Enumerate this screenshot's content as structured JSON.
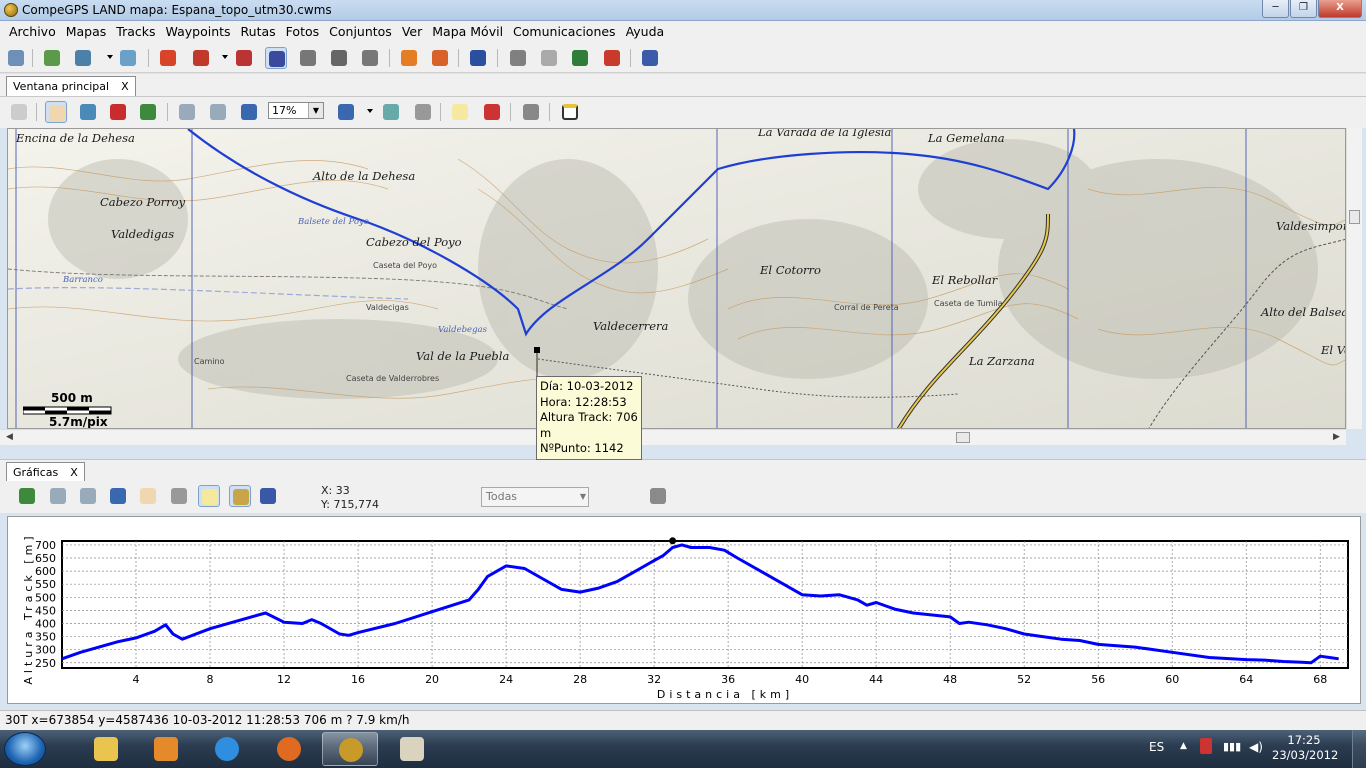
{
  "window": {
    "title": "CompeGPS LAND mapa: Espana_topo_utm30.cwms",
    "buttons": [
      "─",
      "❐",
      "X"
    ]
  },
  "menu": [
    "Archivo",
    "Mapas",
    "Tracks",
    "Waypoints",
    "Rutas",
    "Fotos",
    "Conjuntos",
    "Ver",
    "Mapa Móvil",
    "Comunicaciones",
    "Ayuda"
  ],
  "map_window": {
    "tab_label": "Ventana principal",
    "tab_close": "X",
    "zoom_value": "17%",
    "scale_distance": "500 m",
    "scale_resolution": "5.7m/pix",
    "tooltip": {
      "date": "Día: 10-03-2012",
      "time": "Hora: 12:28:53",
      "altitude": "Altura Track: 706 m",
      "point": "NºPunto: 1142"
    },
    "place_labels": [
      "Encina de la Dehesa",
      "Alto de la Dehesa",
      "Cabezo Porroy",
      "Valdedigas",
      "Cabezo del Poyo",
      "Val de la Puebla",
      "Valdecerrera",
      "La Varada de la Iglesia",
      "La Gemelana",
      "El Cotorro",
      "El Rebollar",
      "La Zarzana",
      "Valdesimpor",
      "Alto del Balsea",
      "El Ve"
    ],
    "small_labels": [
      "Balsete del Poyo",
      "Caseta del Poyo",
      "Valdecigas",
      "Valdebegas",
      "Caseta de Valderrobres",
      "Corral de Pereta",
      "Caseta de Tumila",
      "Barranco",
      "Camino"
    ]
  },
  "graph_window": {
    "tab_label": "Gráficas",
    "tab_close": "X",
    "cursor_x": "X: 33",
    "cursor_y": "Y: 715,774",
    "series_select": "Todas"
  },
  "chart_data": {
    "type": "line",
    "title": "",
    "xlabel": "Distancia [km]",
    "ylabel": "Altura Track [m]",
    "xlim": [
      0,
      69.5
    ],
    "ylim": [
      230,
      715
    ],
    "x_ticks": [
      4,
      8,
      12,
      16,
      20,
      24,
      28,
      32,
      36,
      40,
      44,
      48,
      52,
      56,
      60,
      64,
      68
    ],
    "y_ticks": [
      250,
      300,
      350,
      400,
      450,
      500,
      550,
      600,
      650,
      700
    ],
    "grid": true,
    "line_color": "#0000ff",
    "series": [
      {
        "x": [
          0,
          1,
          2,
          3,
          4,
          5,
          5.6,
          6,
          6.5,
          8,
          10,
          11,
          12,
          13,
          13.5,
          14,
          15,
          15.5,
          16,
          18,
          20,
          22,
          22.5,
          23,
          24,
          25,
          26,
          27,
          28,
          29,
          30,
          31,
          32,
          32.5,
          33,
          33.5,
          34,
          35,
          35.8,
          36.5,
          38,
          40,
          41,
          42,
          43,
          43.5,
          44,
          45,
          46,
          48,
          48.5,
          49,
          50,
          51,
          52,
          53,
          54,
          55,
          56,
          58,
          60,
          62,
          64,
          65,
          66,
          67,
          67.5,
          68,
          68.5,
          69
        ],
        "y": [
          265,
          290,
          310,
          330,
          345,
          370,
          395,
          360,
          340,
          380,
          420,
          440,
          405,
          400,
          415,
          400,
          360,
          355,
          365,
          400,
          445,
          490,
          530,
          580,
          620,
          610,
          570,
          530,
          520,
          535,
          560,
          600,
          640,
          660,
          690,
          700,
          690,
          690,
          680,
          650,
          590,
          510,
          505,
          510,
          490,
          470,
          480,
          455,
          440,
          425,
          400,
          405,
          395,
          380,
          360,
          350,
          340,
          335,
          320,
          310,
          290,
          270,
          262,
          260,
          255,
          252,
          250,
          275,
          270,
          265
        ]
      }
    ],
    "marker": {
      "x": 33,
      "y": 715.774
    }
  },
  "status_bar": "30T  x=673854  y=4587436  10-03-2012  11:28:53  706 m  ?  7.9 km/h",
  "taskbar": {
    "language": "ES",
    "time": "17:25",
    "date": "23/03/2012"
  }
}
